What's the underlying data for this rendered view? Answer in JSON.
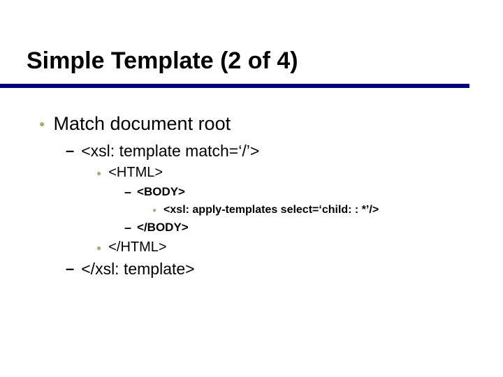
{
  "title": "Simple Template (2 of 4)",
  "l1_1": "Match document root",
  "l2_1": "<xsl: template match=‘/’>",
  "l3_1": "<HTML>",
  "l4_1": "<BODY>",
  "l5_1": "<xsl: apply-templates select=‘child: : *’/>",
  "l4_2": "</BODY>",
  "l3_2": "</HTML>",
  "l2_2": "</xsl: template>"
}
